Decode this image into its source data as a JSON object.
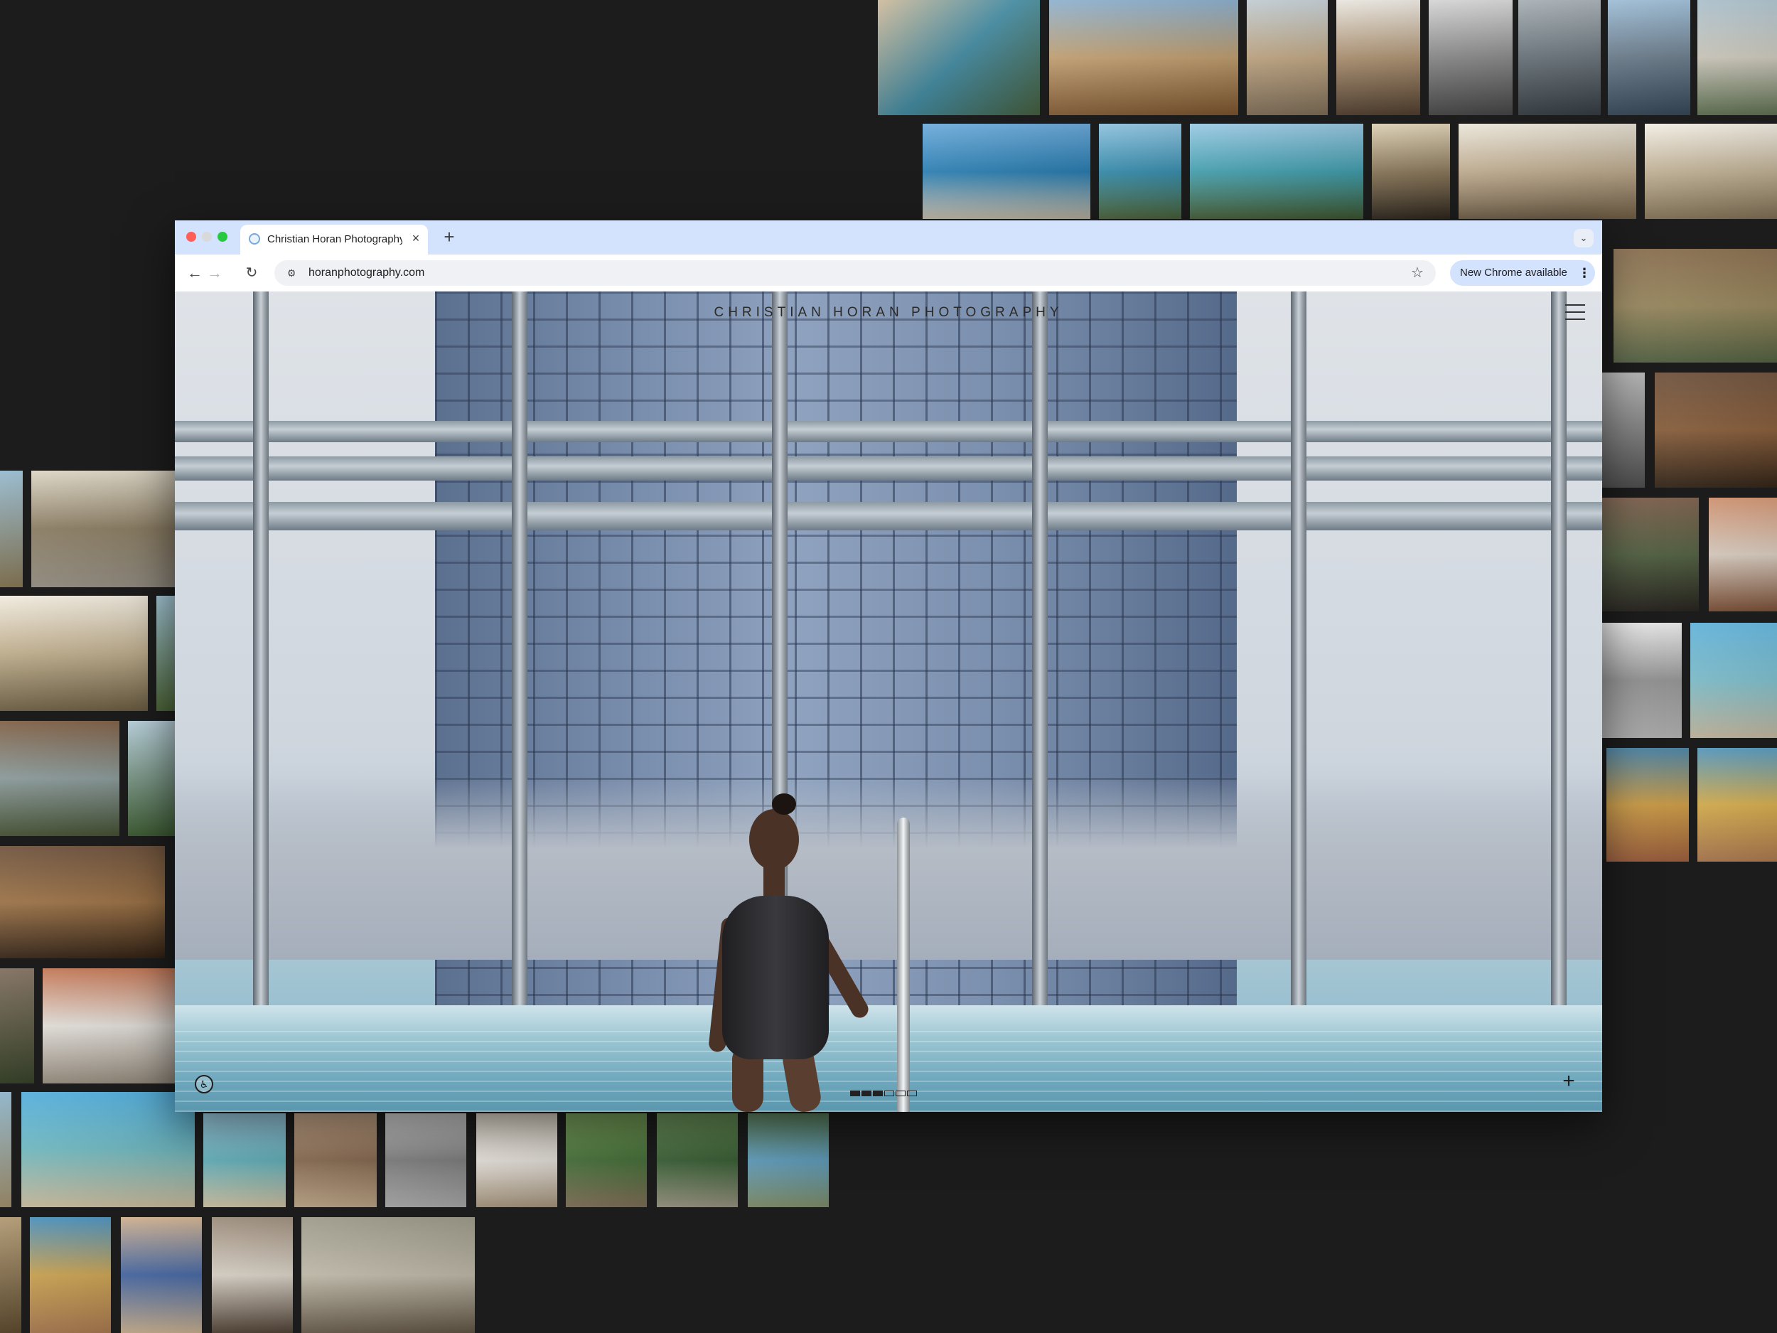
{
  "browser": {
    "tab_title": "Christian Horan Photography",
    "url": "horanphotography.com",
    "update_chip": "New Chrome available",
    "icons": {
      "favicon": "site-favicon",
      "close": "close-icon",
      "new_tab": "plus-icon",
      "tab_search": "chevron-down-icon",
      "back": "arrow-left-icon",
      "forward": "arrow-right-icon",
      "reload": "reload-icon",
      "site_info": "tune-icon",
      "bookmark": "star-icon",
      "menu": "kebab-menu-icon"
    },
    "glyphs": {
      "close": "×",
      "new_tab": "+",
      "tab_search": "⌄",
      "back": "←",
      "forward": "→",
      "reload": "↻",
      "site_info": "⚙",
      "bookmark": "☆",
      "menu": "⋮"
    }
  },
  "site": {
    "title": "CHRISTIAN HORAN PHOTOGRAPHY",
    "accessibility_glyph": "♿",
    "plus_glyph": "+",
    "slides": {
      "total": 6,
      "current": 3
    }
  },
  "colors": {
    "background": "#1c1c1c",
    "tabstrip": "#d3e3fd",
    "chip": "#d3e3fd"
  }
}
